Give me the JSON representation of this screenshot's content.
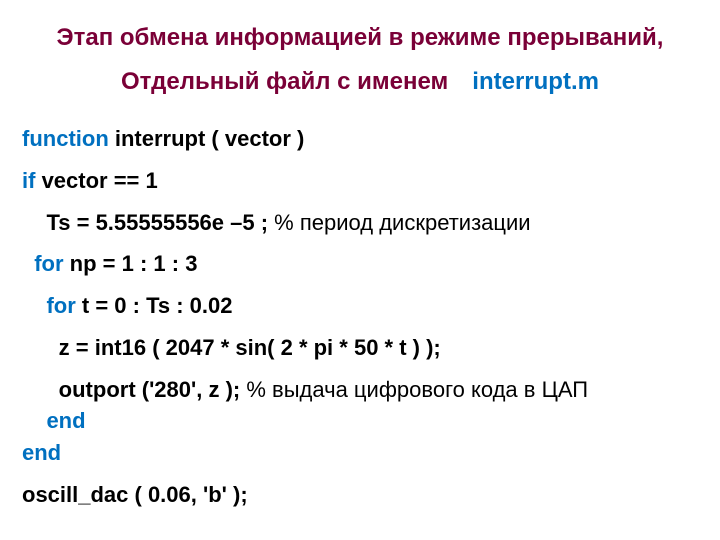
{
  "title": {
    "line1": "Этап обмена информацией в режиме прерываний,",
    "line2_prefix": "Отдельный файл с именем",
    "filename": "interrupt.m"
  },
  "code": {
    "kw_function": "function",
    "sig": " interrupt ( vector )",
    "kw_if": "if",
    "cond": " vector == 1",
    "ts_line": "    Ts = 5.55555556e –5 ; ",
    "ts_comment": "% период дискретизации",
    "kw_for1": "  for",
    "for1_tail": " np = 1 : 1 : 3",
    "kw_for2": "    for",
    "for2_tail": " t = 0 : Ts : 0.02",
    "z_line": "      z = int16 ( 2047 * sin( 2 * pi * 50 * t ) );",
    "out_line": "      outport ('280', z ); ",
    "out_comment": "% выдача цифрового кода в ЦАП",
    "kw_end_inner": "    end",
    "kw_end_outer": "end",
    "oscill": "oscill_dac ( 0.06, 'b' );"
  }
}
